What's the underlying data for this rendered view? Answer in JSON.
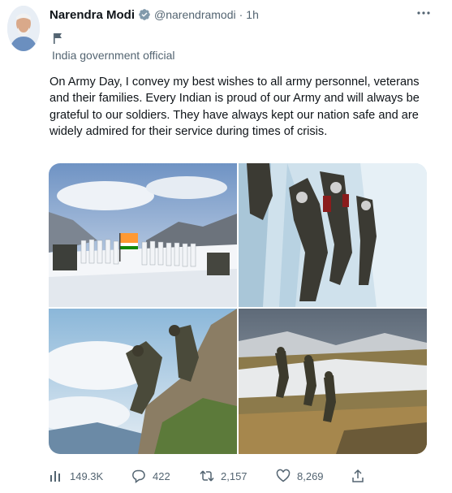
{
  "author": {
    "name": "Narendra Modi",
    "handle": "@narendramodi",
    "separator": "·",
    "time": "1h",
    "affiliation": "India government official"
  },
  "tweet": {
    "text": "On Army Day, I convey my best wishes to all army personnel, veterans and their families. Every Indian is proud of our Army and will always be grateful to our soldiers. They have always kept our nation safe and are widely admired for their service during times of crisis."
  },
  "icons": {
    "more": "more-horizontal-icon",
    "verified": "verified-badge-icon",
    "affiliation": "flag-icon",
    "views": "analytics-icon",
    "replies": "reply-icon",
    "retweets": "retweet-icon",
    "likes": "like-icon",
    "share": "share-icon"
  },
  "stats": {
    "views": "149.3K",
    "replies": "422",
    "retweets": "2,157",
    "likes": "8,269"
  },
  "colors": {
    "verified": "#829aab",
    "secondary_text": "#536471",
    "primary_text": "#0f1419"
  }
}
